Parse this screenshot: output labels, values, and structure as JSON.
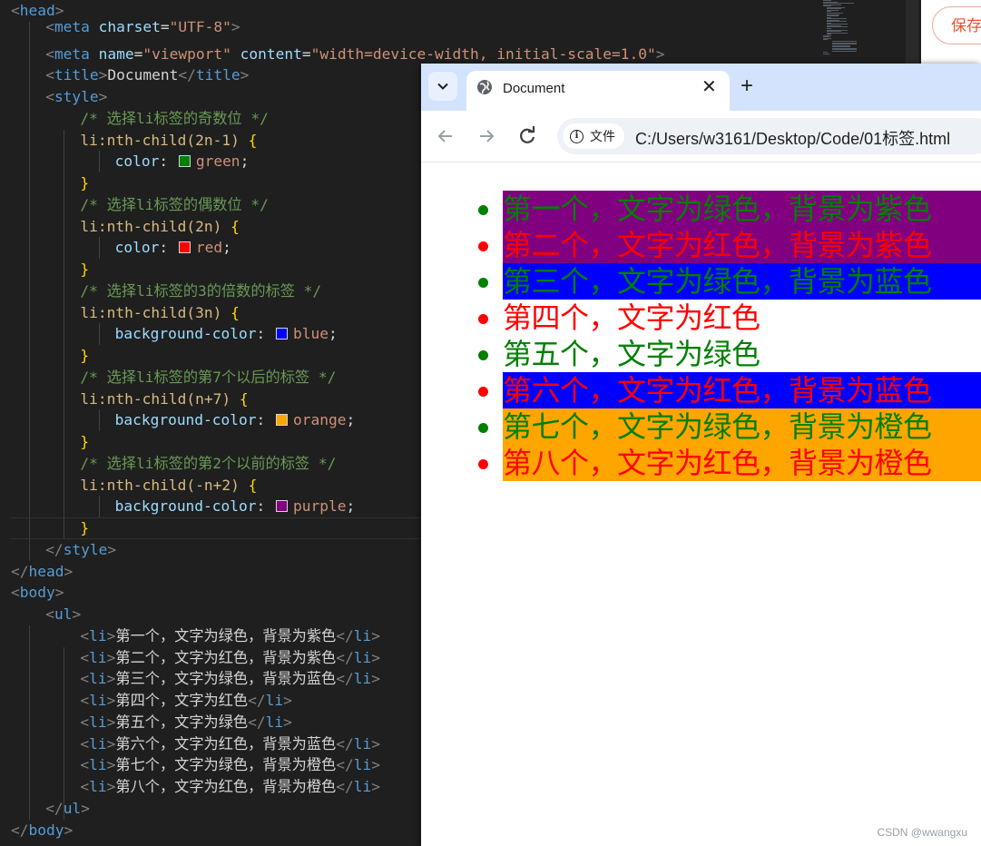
{
  "editor": {
    "lines": [
      {
        "indent": 0,
        "parts": [
          [
            "br",
            "<"
          ],
          [
            "tag",
            "head"
          ],
          [
            "br",
            ">"
          ]
        ]
      },
      {
        "indent": 1,
        "parts": [
          [
            "br",
            "<"
          ],
          [
            "tag",
            "meta"
          ],
          [
            "t",
            " "
          ],
          [
            "attr",
            "charset"
          ],
          [
            "t",
            "="
          ],
          [
            "str",
            "\"UTF-8\""
          ],
          [
            "br",
            ">"
          ]
        ]
      },
      {
        "indent": 1,
        "parts": [
          [
            "br",
            "<"
          ],
          [
            "tag",
            "meta"
          ],
          [
            "t",
            " "
          ],
          [
            "attr",
            "name"
          ],
          [
            "t",
            "="
          ],
          [
            "str",
            "\"viewport\""
          ],
          [
            "t",
            " "
          ],
          [
            "attr",
            "content"
          ],
          [
            "t",
            "="
          ],
          [
            "str",
            "\"width=device-width, initial-scale=1.0\""
          ],
          [
            "br",
            ">"
          ]
        ]
      },
      {
        "indent": 1,
        "parts": [
          [
            "br",
            "<"
          ],
          [
            "tag",
            "title"
          ],
          [
            "br",
            ">"
          ],
          [
            "text",
            "Document"
          ],
          [
            "br",
            "</"
          ],
          [
            "tag",
            "title"
          ],
          [
            "br",
            ">"
          ]
        ]
      },
      {
        "indent": 1,
        "parts": [
          [
            "br",
            "<"
          ],
          [
            "tag",
            "style"
          ],
          [
            "br",
            ">"
          ]
        ]
      },
      {
        "indent": 2,
        "parts": [
          [
            "cmt",
            "/* 选择li标签的奇数位 */"
          ]
        ]
      },
      {
        "indent": 2,
        "parts": [
          [
            "sel",
            "li:nth-child(2n-1)"
          ],
          [
            "t",
            " "
          ],
          [
            "brace",
            "{"
          ]
        ]
      },
      {
        "indent": 3,
        "parts": [
          [
            "prop",
            "color"
          ],
          [
            "punc",
            ": "
          ],
          [
            "swatch",
            "#008000"
          ],
          [
            "val",
            "green"
          ],
          [
            "punc",
            ";"
          ]
        ]
      },
      {
        "indent": 2,
        "parts": [
          [
            "brace",
            "}"
          ]
        ]
      },
      {
        "indent": 2,
        "parts": [
          [
            "cmt",
            "/* 选择li标签的偶数位 */"
          ]
        ]
      },
      {
        "indent": 2,
        "parts": [
          [
            "sel",
            "li:nth-child(2n)"
          ],
          [
            "t",
            " "
          ],
          [
            "brace",
            "{"
          ]
        ]
      },
      {
        "indent": 3,
        "parts": [
          [
            "prop",
            "color"
          ],
          [
            "punc",
            ": "
          ],
          [
            "swatch",
            "#ff0000"
          ],
          [
            "val",
            "red"
          ],
          [
            "punc",
            ";"
          ]
        ]
      },
      {
        "indent": 2,
        "parts": [
          [
            "brace",
            "}"
          ]
        ]
      },
      {
        "indent": 2,
        "parts": [
          [
            "cmt",
            "/* 选择li标签的3的倍数的标签 */"
          ]
        ]
      },
      {
        "indent": 2,
        "parts": [
          [
            "sel",
            "li:nth-child(3n)"
          ],
          [
            "t",
            " "
          ],
          [
            "brace",
            "{"
          ]
        ]
      },
      {
        "indent": 3,
        "parts": [
          [
            "prop",
            "background-color"
          ],
          [
            "punc",
            ": "
          ],
          [
            "swatch",
            "#0000ff"
          ],
          [
            "val",
            "blue"
          ],
          [
            "punc",
            ";"
          ]
        ]
      },
      {
        "indent": 2,
        "parts": [
          [
            "brace",
            "}"
          ]
        ]
      },
      {
        "indent": 2,
        "parts": [
          [
            "cmt",
            "/* 选择li标签的第7个以后的标签 */"
          ]
        ]
      },
      {
        "indent": 2,
        "parts": [
          [
            "sel",
            "li:nth-child(n+7)"
          ],
          [
            "t",
            " "
          ],
          [
            "brace",
            "{"
          ]
        ]
      },
      {
        "indent": 3,
        "parts": [
          [
            "prop",
            "background-color"
          ],
          [
            "punc",
            ": "
          ],
          [
            "swatch",
            "#ffa500"
          ],
          [
            "val",
            "orange"
          ],
          [
            "punc",
            ";"
          ]
        ]
      },
      {
        "indent": 2,
        "parts": [
          [
            "brace",
            "}"
          ]
        ]
      },
      {
        "indent": 2,
        "parts": [
          [
            "cmt",
            "/* 选择li标签的第2个以前的标签 */"
          ]
        ]
      },
      {
        "indent": 2,
        "parts": [
          [
            "sel",
            "li:nth-child(-n+2)"
          ],
          [
            "t",
            " "
          ],
          [
            "brace",
            "{"
          ]
        ]
      },
      {
        "indent": 3,
        "parts": [
          [
            "prop",
            "background-color"
          ],
          [
            "punc",
            ": "
          ],
          [
            "swatch",
            "#800080"
          ],
          [
            "val",
            "purple"
          ],
          [
            "punc",
            ";"
          ]
        ]
      },
      {
        "indent": 2,
        "parts": [
          [
            "brace",
            "}"
          ]
        ]
      },
      {
        "indent": 1,
        "parts": [
          [
            "br",
            "</"
          ],
          [
            "tag",
            "style"
          ],
          [
            "br",
            ">"
          ]
        ]
      },
      {
        "indent": 0,
        "parts": [
          [
            "br",
            "</"
          ],
          [
            "tag",
            "head"
          ],
          [
            "br",
            ">"
          ]
        ]
      },
      {
        "indent": 0,
        "parts": [
          [
            "br",
            "<"
          ],
          [
            "tag",
            "body"
          ],
          [
            "br",
            ">"
          ]
        ]
      },
      {
        "indent": 1,
        "parts": [
          [
            "br",
            "<"
          ],
          [
            "tag",
            "ul"
          ],
          [
            "br",
            ">"
          ]
        ]
      },
      {
        "indent": 2,
        "parts": [
          [
            "br",
            "<"
          ],
          [
            "tag",
            "li"
          ],
          [
            "br",
            ">"
          ],
          [
            "text",
            "第一个，文字为绿色，背景为紫色"
          ],
          [
            "br",
            "</"
          ],
          [
            "tag",
            "li"
          ],
          [
            "br",
            ">"
          ]
        ]
      },
      {
        "indent": 2,
        "parts": [
          [
            "br",
            "<"
          ],
          [
            "tag",
            "li"
          ],
          [
            "br",
            ">"
          ],
          [
            "text",
            "第二个，文字为红色，背景为紫色"
          ],
          [
            "br",
            "</"
          ],
          [
            "tag",
            "li"
          ],
          [
            "br",
            ">"
          ]
        ]
      },
      {
        "indent": 2,
        "parts": [
          [
            "br",
            "<"
          ],
          [
            "tag",
            "li"
          ],
          [
            "br",
            ">"
          ],
          [
            "text",
            "第三个，文字为绿色，背景为蓝色"
          ],
          [
            "br",
            "</"
          ],
          [
            "tag",
            "li"
          ],
          [
            "br",
            ">"
          ]
        ]
      },
      {
        "indent": 2,
        "parts": [
          [
            "br",
            "<"
          ],
          [
            "tag",
            "li"
          ],
          [
            "br",
            ">"
          ],
          [
            "text",
            "第四个，文字为红色"
          ],
          [
            "br",
            "</"
          ],
          [
            "tag",
            "li"
          ],
          [
            "br",
            ">"
          ]
        ]
      },
      {
        "indent": 2,
        "parts": [
          [
            "br",
            "<"
          ],
          [
            "tag",
            "li"
          ],
          [
            "br",
            ">"
          ],
          [
            "text",
            "第五个，文字为绿色"
          ],
          [
            "br",
            "</"
          ],
          [
            "tag",
            "li"
          ],
          [
            "br",
            ">"
          ]
        ]
      },
      {
        "indent": 2,
        "parts": [
          [
            "br",
            "<"
          ],
          [
            "tag",
            "li"
          ],
          [
            "br",
            ">"
          ],
          [
            "text",
            "第六个，文字为红色，背景为蓝色"
          ],
          [
            "br",
            "</"
          ],
          [
            "tag",
            "li"
          ],
          [
            "br",
            ">"
          ]
        ]
      },
      {
        "indent": 2,
        "parts": [
          [
            "br",
            "<"
          ],
          [
            "tag",
            "li"
          ],
          [
            "br",
            ">"
          ],
          [
            "text",
            "第七个，文字为绿色，背景为橙色"
          ],
          [
            "br",
            "</"
          ],
          [
            "tag",
            "li"
          ],
          [
            "br",
            ">"
          ]
        ]
      },
      {
        "indent": 2,
        "parts": [
          [
            "br",
            "<"
          ],
          [
            "tag",
            "li"
          ],
          [
            "br",
            ">"
          ],
          [
            "text",
            "第八个，文字为红色，背景为橙色"
          ],
          [
            "br",
            "</"
          ],
          [
            "tag",
            "li"
          ],
          [
            "br",
            ">"
          ]
        ]
      },
      {
        "indent": 1,
        "parts": [
          [
            "br",
            "</"
          ],
          [
            "tag",
            "ul"
          ],
          [
            "br",
            ">"
          ]
        ]
      },
      {
        "indent": 0,
        "parts": [
          [
            "br",
            "</"
          ],
          [
            "tag",
            "body"
          ],
          [
            "br",
            ">"
          ]
        ]
      }
    ]
  },
  "side_panel": {
    "save_label": "保存"
  },
  "browser": {
    "tab_title": "Document",
    "tab_close": "✕",
    "new_tab": "+",
    "tab_search_icon": "chevron-down-icon",
    "site_info_label": "文件",
    "url": "C:/Users/w3161/Desktop/Code/01标签.html",
    "list_items": [
      {
        "text": "第一个，文字为绿色，背景为紫色",
        "color": "#008000",
        "background": "#800080"
      },
      {
        "text": "第二个，文字为红色，背景为紫色",
        "color": "#ff0000",
        "background": "#800080"
      },
      {
        "text": "第三个，文字为绿色，背景为蓝色",
        "color": "#008000",
        "background": "#0000ff"
      },
      {
        "text": "第四个，文字为红色",
        "color": "#ff0000",
        "background": ""
      },
      {
        "text": "第五个，文字为绿色",
        "color": "#008000",
        "background": ""
      },
      {
        "text": "第六个，文字为红色，背景为蓝色",
        "color": "#ff0000",
        "background": "#0000ff"
      },
      {
        "text": "第七个，文字为绿色，背景为橙色",
        "color": "#008000",
        "background": "#ffa500"
      },
      {
        "text": "第八个，文字为红色，背景为橙色",
        "color": "#ff0000",
        "background": "#ffa500"
      }
    ]
  },
  "watermark": "CSDN @wwangxu"
}
